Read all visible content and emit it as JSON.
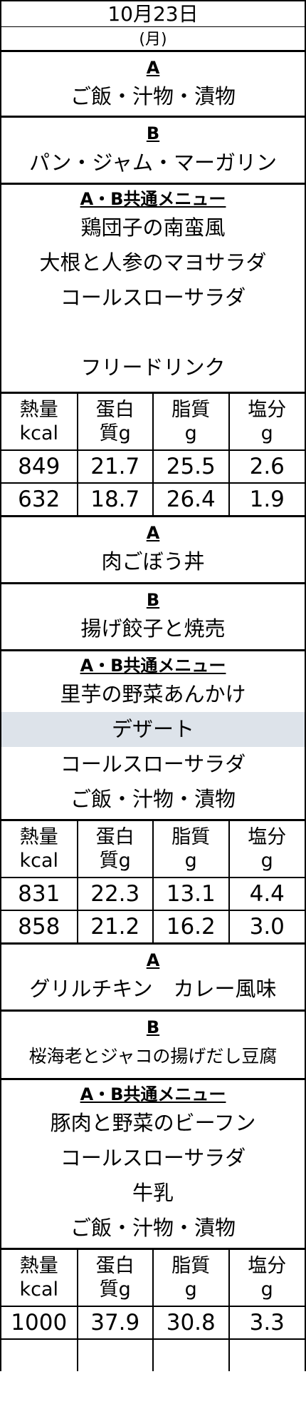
{
  "date": "10月23日",
  "weekday": "(月)",
  "columns": [
    "熱量",
    "kcal",
    "蛋白",
    "質g",
    "脂質",
    "g",
    "塩分",
    "g"
  ],
  "meals": [
    {
      "a_label": "A",
      "a_text": "ご飯・汁物・漬物",
      "b_label": "B",
      "b_text": "パン・ジャム・マーガリン",
      "common_label": "A・B共通メニュー",
      "common": [
        "鶏団子の南蛮風",
        "大根と人参のマヨサラダ",
        "コールスローサラダ",
        "",
        "フリードリンク"
      ],
      "nutrition": [
        [
          "849",
          "21.7",
          "25.5",
          "2.6"
        ],
        [
          "632",
          "18.7",
          "26.4",
          "1.9"
        ]
      ]
    },
    {
      "a_label": "A",
      "a_text": "肉ごぼう丼",
      "b_label": "B",
      "b_text": "揚げ餃子と焼売",
      "common_label": "A・B共通メニュー",
      "common": [
        "里芋の野菜あんかけ",
        "デザート",
        "コールスローサラダ",
        "ご飯・汁物・漬物"
      ],
      "nutrition": [
        [
          "831",
          "22.3",
          "13.1",
          "4.4"
        ],
        [
          "858",
          "21.2",
          "16.2",
          "3.0"
        ]
      ]
    },
    {
      "a_label": "A",
      "a_text": "グリルチキン　カレー風味",
      "b_label": "B",
      "b_text": "桜海老とジャコの揚げだし豆腐",
      "common_label": "A・B共通メニュー",
      "common": [
        "豚肉と野菜のビーフン",
        "コールスローサラダ",
        "牛乳",
        "ご飯・汁物・漬物"
      ],
      "nutrition": [
        [
          "1000",
          "37.9",
          "30.8",
          "3.3"
        ]
      ]
    }
  ]
}
